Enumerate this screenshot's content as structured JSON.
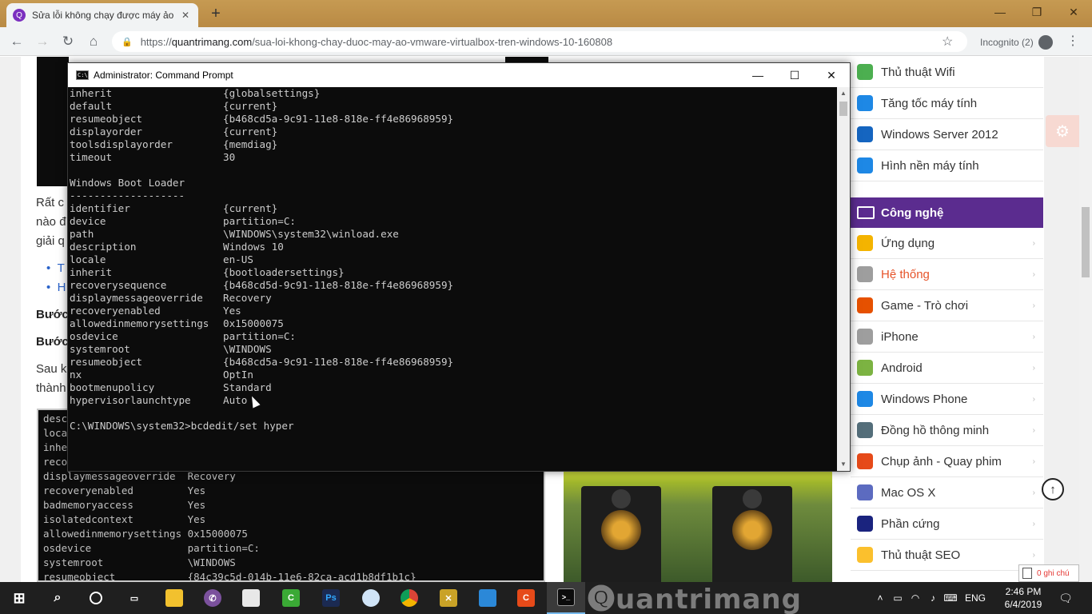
{
  "browser": {
    "tab_title": "Sửa lỗi không chạy được máy ảo",
    "tab_favicon": "Q",
    "url_host": "quantrimang.com",
    "url_prefix": "https://",
    "url_path": "/sua-loi-khong-chay-duoc-may-ao-vmware-virtualbox-tren-windows-10-160808",
    "incognito_label": "Incognito (2)"
  },
  "article": {
    "frag1": "Rất c",
    "frag2": "nào đ",
    "frag3": "giải q",
    "bullet1": "T",
    "bullet2": "H",
    "step1": "Bước",
    "step2": "Bước",
    "frag4": "Sau k",
    "frag5": "thành"
  },
  "inner_terminal": {
    "lines": [
      "desc",
      "loca",
      "inhe",
      "reco",
      "displaymessageoverride  Recovery",
      "recoveryenabled         Yes",
      "badmemoryaccess         Yes",
      "isolatedcontext         Yes",
      "allowedinmemorysettings 0x15000075",
      "osdevice                partition=C:",
      "systemroot              \\WINDOWS",
      "resumeobject            {84c39c5d-014b-11e6-82ca-acd1b8df1b1c}"
    ]
  },
  "sidebar": {
    "top_items": [
      {
        "label": "Thủ thuật Wifi",
        "icon": "wifi-icon",
        "color": "#4caf50"
      },
      {
        "label": "Tăng tốc máy tính",
        "icon": "monitor-icon",
        "color": "#1e88e5"
      },
      {
        "label": "Windows Server 2012",
        "icon": "windows-icon",
        "color": "#1565c0"
      },
      {
        "label": "Hình nền máy tính",
        "icon": "check-badge-icon",
        "color": "#1e88e5"
      }
    ],
    "section_title": "Công nghệ",
    "items": [
      {
        "label": "Ứng dụng",
        "icon": "apps-icon",
        "color": "#f4b400"
      },
      {
        "label": "Hệ thống",
        "icon": "system-icon",
        "color": "#9e9e9e"
      },
      {
        "label": "Game - Trò chơi",
        "icon": "gamepad-icon",
        "color": "#e65100"
      },
      {
        "label": "iPhone",
        "icon": "apple-icon",
        "color": "#9e9e9e"
      },
      {
        "label": "Android",
        "icon": "android-icon",
        "color": "#7cb342"
      },
      {
        "label": "Windows Phone",
        "icon": "windows-phone-icon",
        "color": "#1e88e5"
      },
      {
        "label": "Đồng hồ thông minh",
        "icon": "smartwatch-icon",
        "color": "#546e7a"
      },
      {
        "label": "Chụp ảnh - Quay phim",
        "icon": "camera-icon",
        "color": "#e64a19"
      },
      {
        "label": "Mac OS X",
        "icon": "mac-icon",
        "color": "#5c6bc0"
      },
      {
        "label": "Phần cứng",
        "icon": "hardware-icon",
        "color": "#1a237e"
      },
      {
        "label": "Thủ thuật SEO",
        "icon": "seo-icon",
        "color": "#fbc02d"
      }
    ],
    "note_label": "0 ghi chú"
  },
  "cmd": {
    "title": "Administrator: Command Prompt",
    "lines": [
      {
        "k": "inherit",
        "v": "{globalsettings}"
      },
      {
        "k": "default",
        "v": "{current}"
      },
      {
        "k": "resumeobject",
        "v": "{b468cd5a-9c91-11e8-818e-ff4e86968959}"
      },
      {
        "k": "displayorder",
        "v": "{current}"
      },
      {
        "k": "toolsdisplayorder",
        "v": "{memdiag}"
      },
      {
        "k": "timeout",
        "v": "30"
      },
      {
        "k": "",
        "v": ""
      },
      {
        "k": "Windows Boot Loader",
        "v": ""
      },
      {
        "k": "-------------------",
        "v": ""
      },
      {
        "k": "identifier",
        "v": "{current}"
      },
      {
        "k": "device",
        "v": "partition=C:"
      },
      {
        "k": "path",
        "v": "\\WINDOWS\\system32\\winload.exe"
      },
      {
        "k": "description",
        "v": "Windows 10"
      },
      {
        "k": "locale",
        "v": "en-US"
      },
      {
        "k": "inherit",
        "v": "{bootloadersettings}"
      },
      {
        "k": "recoverysequence",
        "v": "{b468cd5d-9c91-11e8-818e-ff4e86968959}"
      },
      {
        "k": "displaymessageoverride",
        "v": "Recovery"
      },
      {
        "k": "recoveryenabled",
        "v": "Yes"
      },
      {
        "k": "allowedinmemorysettings",
        "v": "0x15000075"
      },
      {
        "k": "osdevice",
        "v": "partition=C:"
      },
      {
        "k": "systemroot",
        "v": "\\WINDOWS"
      },
      {
        "k": "resumeobject",
        "v": "{b468cd5a-9c91-11e8-818e-ff4e86968959}"
      },
      {
        "k": "nx",
        "v": "OptIn"
      },
      {
        "k": "bootmenupolicy",
        "v": "Standard"
      },
      {
        "k": "hypervisorlaunchtype",
        "v": "Auto"
      },
      {
        "k": "",
        "v": ""
      },
      {
        "k": "C:\\WINDOWS\\system32>bcdedit/set hyper",
        "v": ""
      }
    ]
  },
  "taskbar": {
    "language": "ENG",
    "time": "2:46 PM",
    "date": "6/4/2019",
    "watermark": "uantrimang"
  }
}
